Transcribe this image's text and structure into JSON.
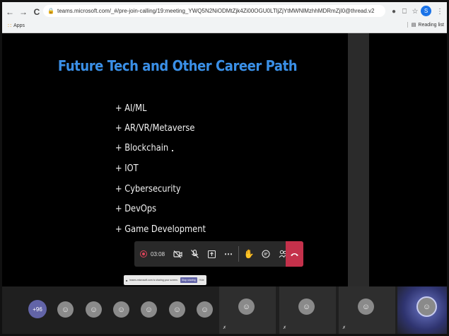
{
  "browser": {
    "url": "teams.microsoft.com/_#/pre-join-calling/19:meeting_YWQ5N2NiODMtZjk4Zi00OGU0LTljZjYtMWNlMzhhMDRmZjI0@thread.v2",
    "bookmarks": {
      "apps_label": "Apps",
      "reading_list_label": "Reading list"
    },
    "profile_initial": "S"
  },
  "slide": {
    "title": "Future Tech and Other Career Path",
    "title_color": "#3a8fe6",
    "bullets": [
      "+ AI/ML",
      "+ AR/VR/Metaverse",
      "+ Blockchain",
      "+ IOT",
      "+ Cybersecurity",
      "+ DevOps",
      "+ Game Development"
    ]
  },
  "call_controls": {
    "timer": "03:08",
    "hangup_color": "#c4314b"
  },
  "notice": {
    "text": "teams.microsoft.com is sharing your screen.",
    "stop_label": "Stop sharing",
    "hide_label": "Hide"
  },
  "participants": {
    "overflow_count": "+96",
    "accent": "#6264a7"
  }
}
